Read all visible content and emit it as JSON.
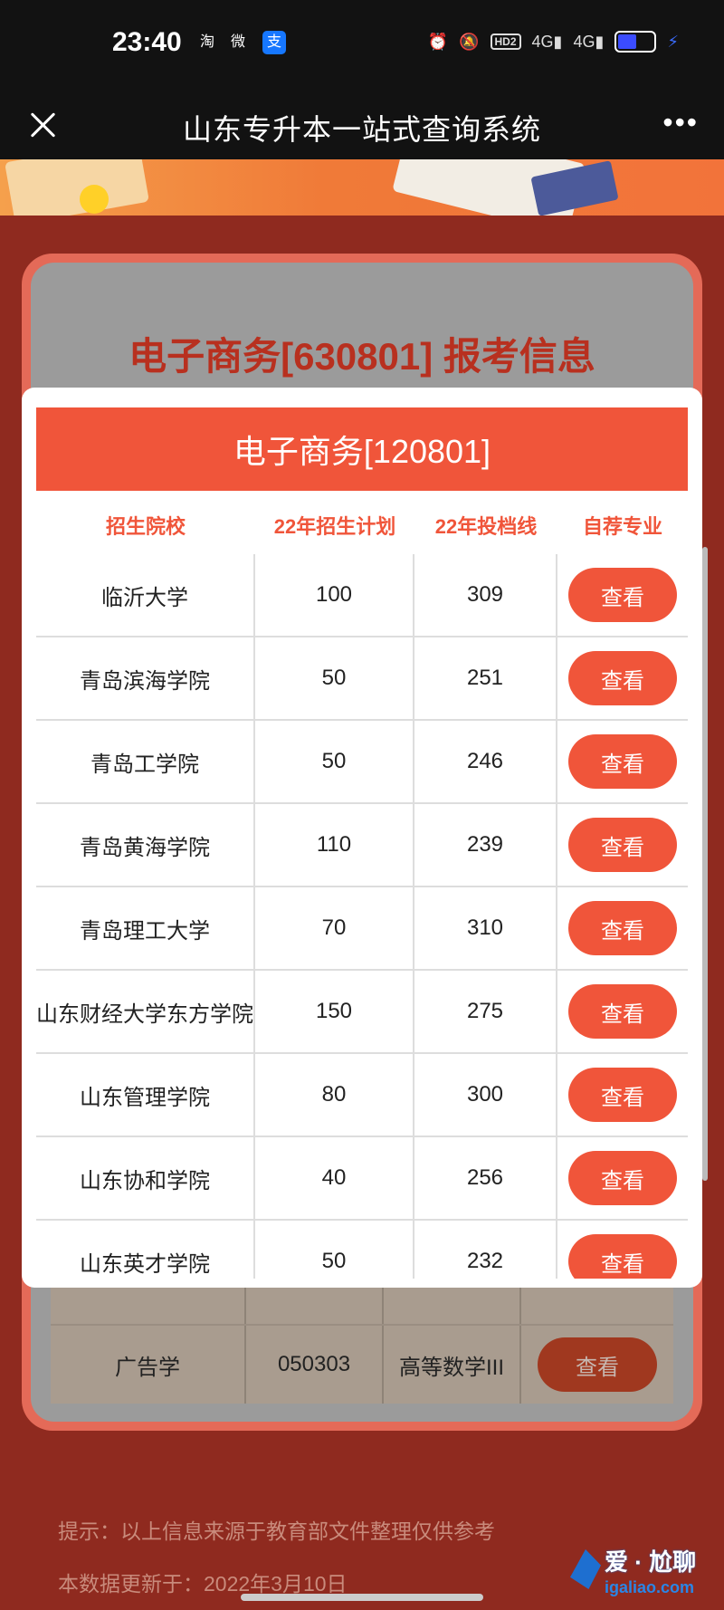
{
  "status_bar": {
    "time": "23:40",
    "app_icons": [
      "淘",
      "微",
      "支"
    ],
    "indicators": [
      "alarm-icon",
      "mute-icon",
      "HD2",
      "4G",
      "4G"
    ]
  },
  "header": {
    "title": "山东专升本一站式查询系统"
  },
  "background": {
    "title": "电子商务[630801] 报考信息",
    "rows": [
      {
        "major": "广告学",
        "code": "050303",
        "subject": "高等数学III",
        "action": "查看"
      }
    ],
    "tip": "提示：以上信息来源于教育部文件整理仅供参考",
    "update_note": "本数据更新于：2022年3月10日"
  },
  "modal": {
    "title": "电子商务[120801]",
    "columns": [
      "招生院校",
      "22年招生计划",
      "22年投档线",
      "自荐专业"
    ],
    "rows": [
      {
        "school": "临沂大学",
        "plan": "100",
        "score": "309",
        "action": "查看"
      },
      {
        "school": "青岛滨海学院",
        "plan": "50",
        "score": "251",
        "action": "查看"
      },
      {
        "school": "青岛工学院",
        "plan": "50",
        "score": "246",
        "action": "查看"
      },
      {
        "school": "青岛黄海学院",
        "plan": "110",
        "score": "239",
        "action": "查看"
      },
      {
        "school": "青岛理工大学",
        "plan": "70",
        "score": "310",
        "action": "查看"
      },
      {
        "school": "山东财经大学东方学院",
        "plan": "150",
        "score": "275",
        "action": "查看"
      },
      {
        "school": "山东管理学院",
        "plan": "80",
        "score": "300",
        "action": "查看"
      },
      {
        "school": "山东协和学院",
        "plan": "40",
        "score": "256",
        "action": "查看"
      },
      {
        "school": "山东英才学院",
        "plan": "50",
        "score": "232",
        "action": "查看"
      }
    ]
  },
  "watermark": {
    "text": "爱 · 尬聊",
    "url": "igaliao.com"
  },
  "colors": {
    "accent": "#f0553a",
    "background": "#8f2a1f"
  }
}
